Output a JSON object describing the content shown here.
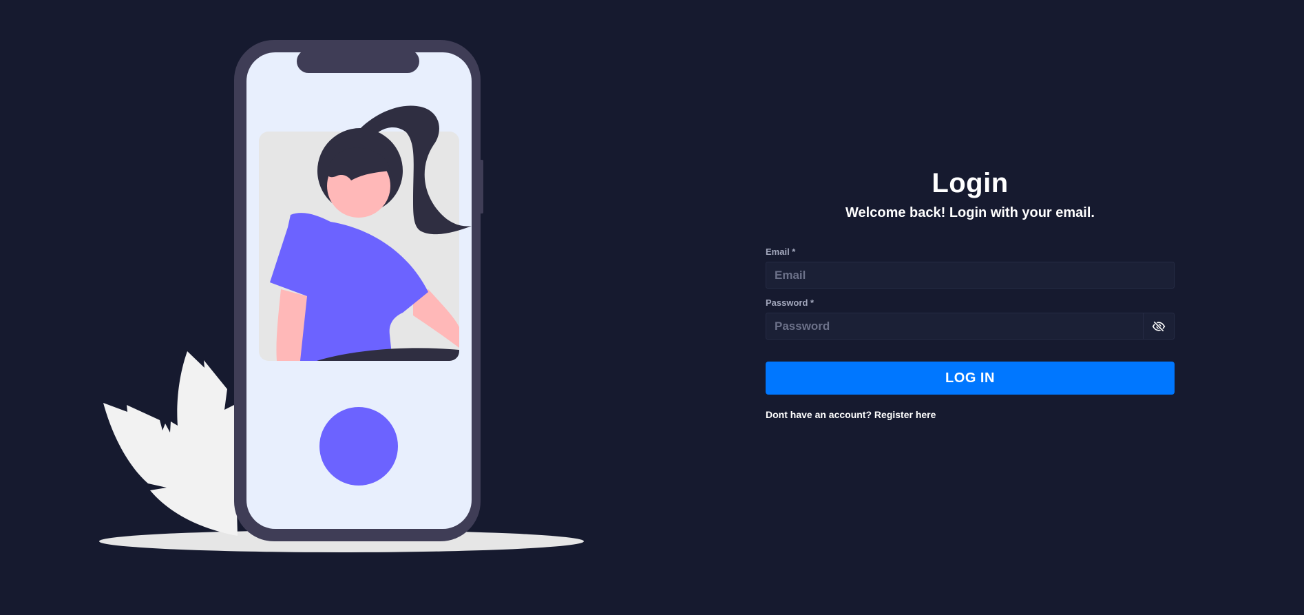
{
  "login": {
    "title": "Login",
    "subtitle": "Welcome back! Login with your email.",
    "email_label": "Email *",
    "email_placeholder": "Email",
    "email_value": "",
    "password_label": "Password *",
    "password_placeholder": "Password",
    "password_value": "",
    "password_toggle_icon": "eye-slash-icon",
    "submit_label": "LOG IN",
    "register_prompt": "Dont have an account?",
    "register_link": "Register here"
  },
  "colors": {
    "background": "#161a2f",
    "accent": "#0077ff",
    "input_background": "#1b2036",
    "illustration_purple": "#6c63ff",
    "phone_frame": "#3f3d56"
  }
}
